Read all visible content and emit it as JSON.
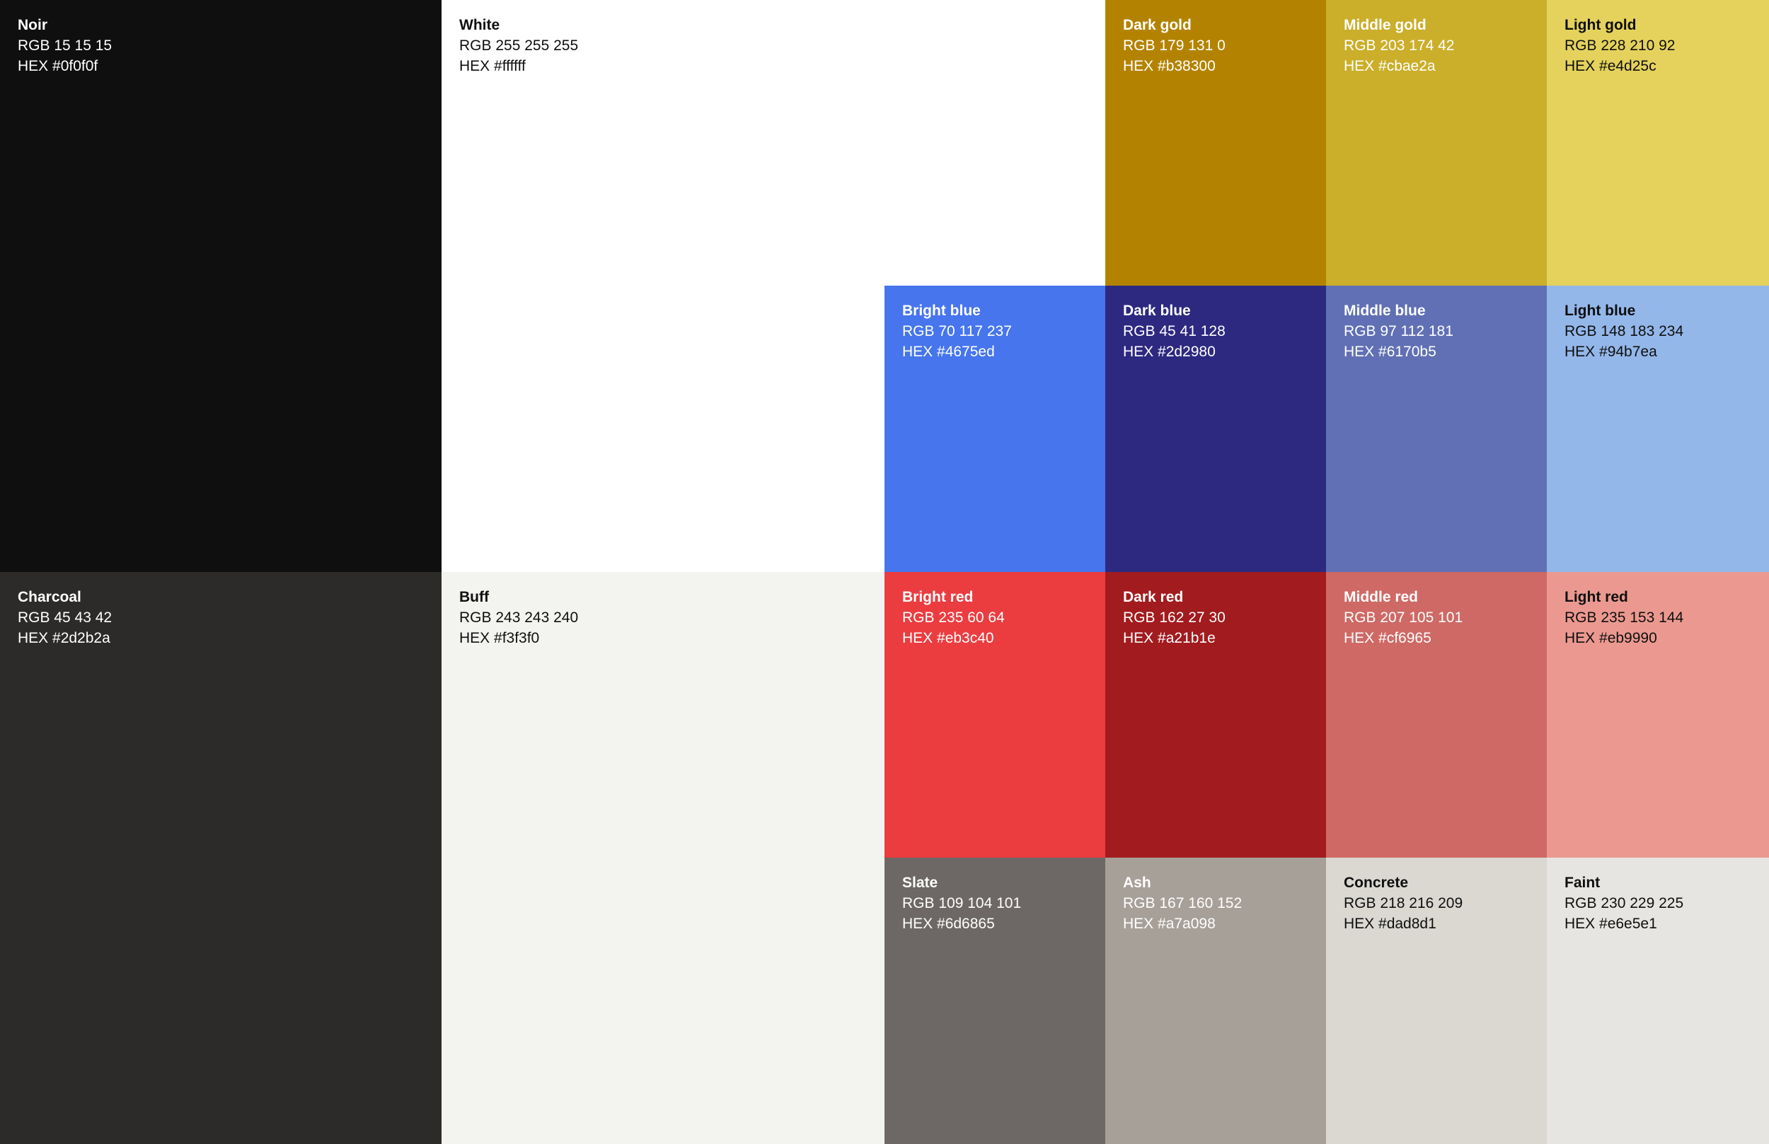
{
  "palette": {
    "swatches": [
      {
        "id": "noir",
        "name": "Noir",
        "rgb": "RGB 15 15 15",
        "hex": "HEX #0f0f0f",
        "color": "#0f0f0f",
        "text_color": "#ffffff"
      },
      {
        "id": "white",
        "name": "White",
        "rgb": "RGB 255 255 255",
        "hex": "HEX #ffffff",
        "color": "#ffffff",
        "text_color": "#0f0f0f"
      },
      {
        "id": "dark-gold",
        "name": "Dark gold",
        "rgb": "RGB 179 131 0",
        "hex": "HEX #b38300",
        "color": "#b38300",
        "text_color": "#ffffff"
      },
      {
        "id": "middle-gold",
        "name": "Middle gold",
        "rgb": "RGB 203 174 42",
        "hex": "HEX #cbae2a",
        "color": "#cbae2a",
        "text_color": "#ffffff"
      },
      {
        "id": "light-gold",
        "name": "Light gold",
        "rgb": "RGB 228 210 92",
        "hex": "HEX #e4d25c",
        "color": "#e4d25c",
        "text_color": "#0f0f0f"
      },
      {
        "id": "bright-blue",
        "name": "Bright blue",
        "rgb": "RGB 70 117 237",
        "hex": "HEX #4675ed",
        "color": "#4675ed",
        "text_color": "#ffffff"
      },
      {
        "id": "dark-blue",
        "name": "Dark blue",
        "rgb": "RGB 45 41 128",
        "hex": "HEX #2d2980",
        "color": "#2d2980",
        "text_color": "#ffffff"
      },
      {
        "id": "middle-blue",
        "name": "Middle blue",
        "rgb": "RGB 97 112 181",
        "hex": "HEX #6170b5",
        "color": "#6170b5",
        "text_color": "#ffffff"
      },
      {
        "id": "light-blue",
        "name": "Light blue",
        "rgb": "RGB 148 183 234",
        "hex": "HEX #94b7ea",
        "color": "#94b7ea",
        "text_color": "#0f0f0f"
      },
      {
        "id": "charcoal",
        "name": "Charcoal",
        "rgb": "RGB 45 43 42",
        "hex": "HEX #2d2b2a",
        "color": "#2d2b2a",
        "text_color": "#ffffff"
      },
      {
        "id": "buff",
        "name": "Buff",
        "rgb": "RGB 243 243 240",
        "hex": "HEX #f3f3f0",
        "color": "#f3f3f0",
        "text_color": "#0f0f0f"
      },
      {
        "id": "bright-red",
        "name": "Bright red",
        "rgb": "RGB 235 60 64",
        "hex": "HEX #eb3c40",
        "color": "#eb3c40",
        "text_color": "#ffffff"
      },
      {
        "id": "dark-red",
        "name": "Dark red",
        "rgb": "RGB 162 27 30",
        "hex": "HEX #a21b1e",
        "color": "#a21b1e",
        "text_color": "#ffffff"
      },
      {
        "id": "middle-red",
        "name": "Middle red",
        "rgb": "RGB 207 105 101",
        "hex": "HEX #cf6965",
        "color": "#cf6965",
        "text_color": "#ffffff"
      },
      {
        "id": "light-red",
        "name": "Light red",
        "rgb": "RGB 235 153 144",
        "hex": "HEX #eb9990",
        "color": "#eb9990",
        "text_color": "#0f0f0f"
      },
      {
        "id": "slate",
        "name": "Slate",
        "rgb": "RGB 109 104 101",
        "hex": "HEX #6d6865",
        "color": "#6d6865",
        "text_color": "#ffffff"
      },
      {
        "id": "ash",
        "name": "Ash",
        "rgb": "RGB 167 160 152",
        "hex": "HEX #a7a098",
        "color": "#a7a098",
        "text_color": "#ffffff"
      },
      {
        "id": "concrete",
        "name": "Concrete",
        "rgb": "RGB 218 216 209",
        "hex": "HEX #dad8d1",
        "color": "#dad8d1",
        "text_color": "#0f0f0f"
      },
      {
        "id": "faint",
        "name": "Faint",
        "rgb": "RGB 230 229 225",
        "hex": "HEX #e6e5e1",
        "color": "#e6e5e1",
        "text_color": "#0f0f0f"
      }
    ]
  }
}
